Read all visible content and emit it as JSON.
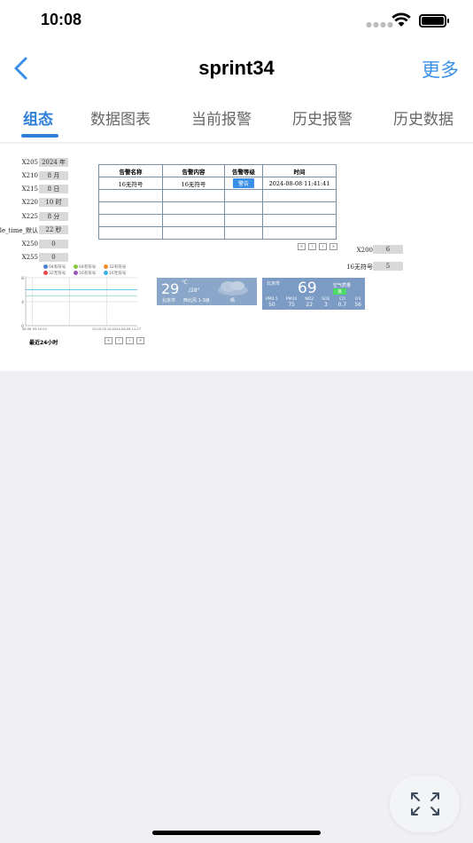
{
  "status_bar": {
    "time": "10:08"
  },
  "nav": {
    "title": "sprint34",
    "more_label": "更多"
  },
  "tabs": [
    {
      "label": "组态",
      "active": true
    },
    {
      "label": "数据图表",
      "active": false
    },
    {
      "label": "当前报警",
      "active": false
    },
    {
      "label": "历史报警",
      "active": false
    },
    {
      "label": "历史数据",
      "active": false
    }
  ],
  "fields": [
    {
      "label": "X205",
      "value": "2024 年"
    },
    {
      "label": "X210",
      "value": "8 月"
    },
    {
      "label": "X215",
      "value": "8 日"
    },
    {
      "label": "X220",
      "value": "10 时"
    },
    {
      "label": "X225",
      "value": "8 分"
    },
    {
      "label": "able_time_默认",
      "value": "22 秒"
    },
    {
      "label": "X250",
      "value": "0"
    },
    {
      "label": "X255",
      "value": "0"
    }
  ],
  "right_fields": [
    {
      "label": "X200",
      "value": "6"
    },
    {
      "label": "16无符号",
      "value": "5"
    }
  ],
  "alarm_table": {
    "headers": [
      "告警名称",
      "告警内容",
      "告警等级",
      "时间"
    ],
    "rows": [
      {
        "name": "16无符号",
        "content": "16无符号",
        "level": "警告",
        "time": "2024-08-08 11:41:41"
      }
    ]
  },
  "pager_symbols": [
    "«",
    "‹",
    "›",
    "»"
  ],
  "chart": {
    "legend": [
      "04有符号",
      "04有符号",
      "32有符号",
      "32无符号",
      "16有符号",
      "16无符号"
    ],
    "legend_colors": [
      "#4a7fd4",
      "#8cc63f",
      "#f28c28",
      "#e84a4a",
      "#9b59b6",
      "#3ab0e2"
    ],
    "y_ticks": [
      "8",
      "4",
      "0"
    ],
    "x_ticks": [
      "08-08 09:10:20",
      "10:10:20",
      "10:2024-08-08 11:27"
    ],
    "footer": "最近24小时"
  },
  "chart_data": {
    "type": "line",
    "x": [
      "08-08 09:10:20",
      "10:10:20",
      "10:2024-08-08 11:27"
    ],
    "series": [
      {
        "name": "04有符号",
        "values": [
          6,
          6,
          6
        ]
      },
      {
        "name": "16无符号",
        "values": [
          5,
          5,
          5
        ]
      }
    ],
    "ylim": [
      0,
      8
    ],
    "xlabel": "",
    "ylabel": "",
    "title": ""
  },
  "weather": {
    "temp": "29",
    "unit": "℃",
    "sub": "/28°",
    "location": "北京市",
    "wind": "西北风 1-3级",
    "cond": "晴"
  },
  "aqi": {
    "location": "北京市",
    "value": "69",
    "label": "空气质量",
    "level": "良",
    "metrics": [
      {
        "name": "PM2.5",
        "value": "50"
      },
      {
        "name": "PM10",
        "value": "75"
      },
      {
        "name": "NO2",
        "value": "22"
      },
      {
        "name": "SO2",
        "value": "3"
      },
      {
        "name": "CO",
        "value": "0.7"
      },
      {
        "name": "O3",
        "value": "56"
      }
    ]
  }
}
